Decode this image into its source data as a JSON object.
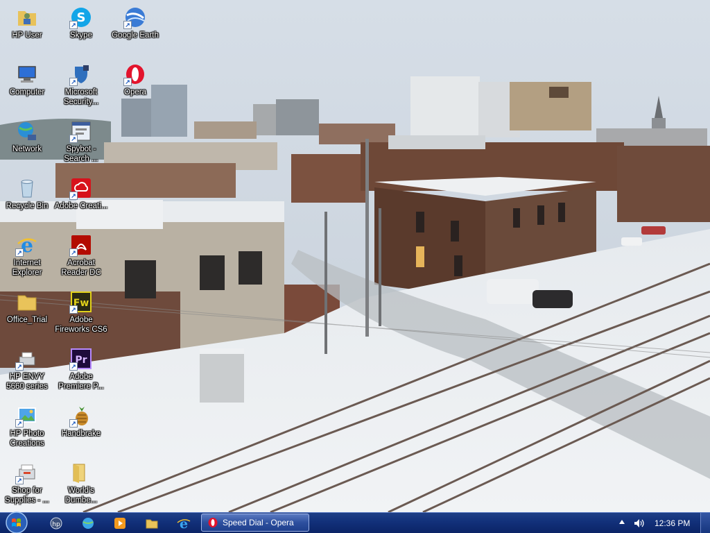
{
  "desktop": {
    "icons": [
      {
        "label": "HP User",
        "icon": "user-folder-icon"
      },
      {
        "label": "Skype",
        "icon": "skype-icon"
      },
      {
        "label": "Google Earth",
        "icon": "google-earth-icon"
      },
      {
        "label": "Computer",
        "icon": "computer-icon"
      },
      {
        "label": "Microsoft Security...",
        "icon": "microsoft-security-icon"
      },
      {
        "label": "Opera",
        "icon": "opera-icon"
      },
      {
        "label": "Network",
        "icon": "network-icon"
      },
      {
        "label": "Spybot - Search ...",
        "icon": "spybot-icon"
      },
      {
        "label": "Recycle Bin",
        "icon": "recycle-bin-icon"
      },
      {
        "label": "Adobe Creati...",
        "icon": "adobe-creative-cloud-icon"
      },
      {
        "label": "Internet Explorer",
        "icon": "internet-explorer-icon"
      },
      {
        "label": "Acrobat Reader DC",
        "icon": "acrobat-reader-icon"
      },
      {
        "label": "Office_Trial",
        "icon": "folder-icon"
      },
      {
        "label": "Adobe Fireworks CS6",
        "icon": "fireworks-icon"
      },
      {
        "label": "HP ENVY 5660 series",
        "icon": "printer-icon"
      },
      {
        "label": "Adobe Premiere P...",
        "icon": "premiere-icon"
      },
      {
        "label": "HP Photo Creations",
        "icon": "hp-photo-icon"
      },
      {
        "label": "Handbrake",
        "icon": "handbrake-icon"
      },
      {
        "label": "Shop for Supplies - ...",
        "icon": "shop-supplies-icon"
      },
      {
        "label": "World's Dumbe...",
        "icon": "folder-icon"
      }
    ]
  },
  "taskbar": {
    "start": {
      "icon": "windows-start-icon"
    },
    "quick_launch": [
      {
        "icon": "hp-support-icon"
      },
      {
        "icon": "globe-icon"
      },
      {
        "icon": "media-player-icon"
      },
      {
        "icon": "file-explorer-icon"
      },
      {
        "icon": "internet-explorer-icon"
      }
    ],
    "active_window": {
      "label": "Speed Dial - Opera",
      "icon": "opera-icon"
    },
    "clock": "12:36 PM"
  },
  "colors": {
    "taskbar": "#12307a",
    "sky": "#cfd8e2",
    "snow": "#e9edf0",
    "brick": "#5a3a2c"
  }
}
